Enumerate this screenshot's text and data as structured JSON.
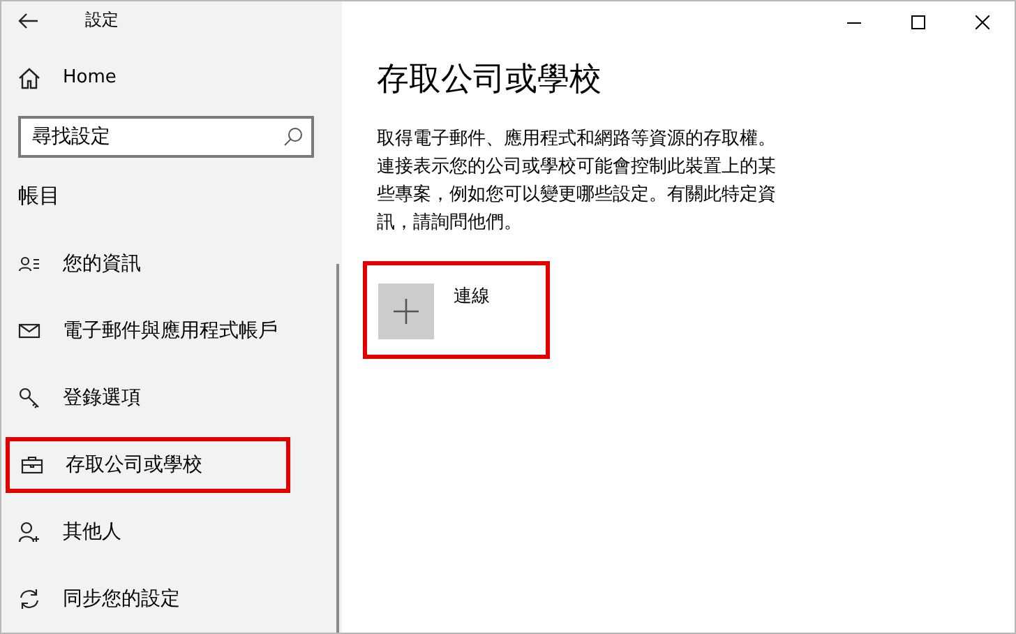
{
  "window": {
    "title": "設定"
  },
  "sidebar": {
    "home": "Home",
    "search": {
      "placeholder": "尋找設定"
    },
    "section": "帳目",
    "items": [
      {
        "kind": "person-list",
        "label": "您的資訊",
        "highlighted": false
      },
      {
        "kind": "mail",
        "label": "電子郵件與應用程式帳戶",
        "highlighted": false
      },
      {
        "kind": "key",
        "label": "登錄選項",
        "highlighted": false
      },
      {
        "kind": "briefcase",
        "label": "存取公司或學校",
        "highlighted": true
      },
      {
        "kind": "person-add",
        "label": "其他人",
        "highlighted": false
      },
      {
        "kind": "sync",
        "label": "同步您的設定",
        "highlighted": false
      }
    ]
  },
  "content": {
    "heading": "存取公司或學校",
    "description": "取得電子郵件、應用程式和網路等資源的存取權。連接表示您的公司或學校可能會控制此裝置上的某些專案，例如您可以變更哪些設定。有關此特定資訊，請詢問他們。",
    "connect": {
      "label": "連線",
      "highlighted": true
    }
  }
}
